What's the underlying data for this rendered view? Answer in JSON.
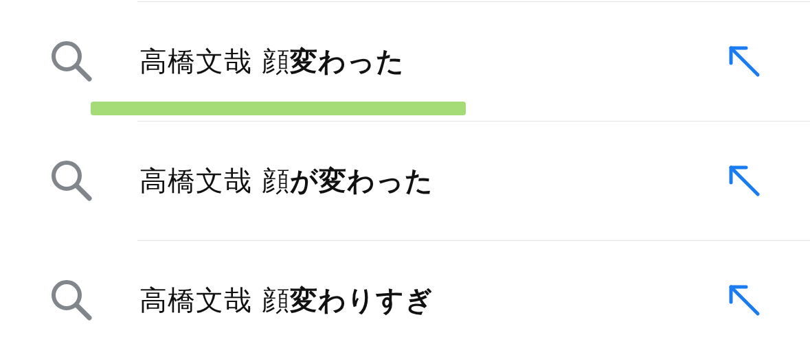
{
  "suggestions": [
    {
      "text": "高橋文哉 顔**変わった**",
      "underlined": true
    },
    {
      "text": "高橋文哉 顔**が変わった**",
      "underlined": false
    },
    {
      "text": "高橋文哉 顔**変わりすぎ**",
      "underlined": false
    }
  ]
}
